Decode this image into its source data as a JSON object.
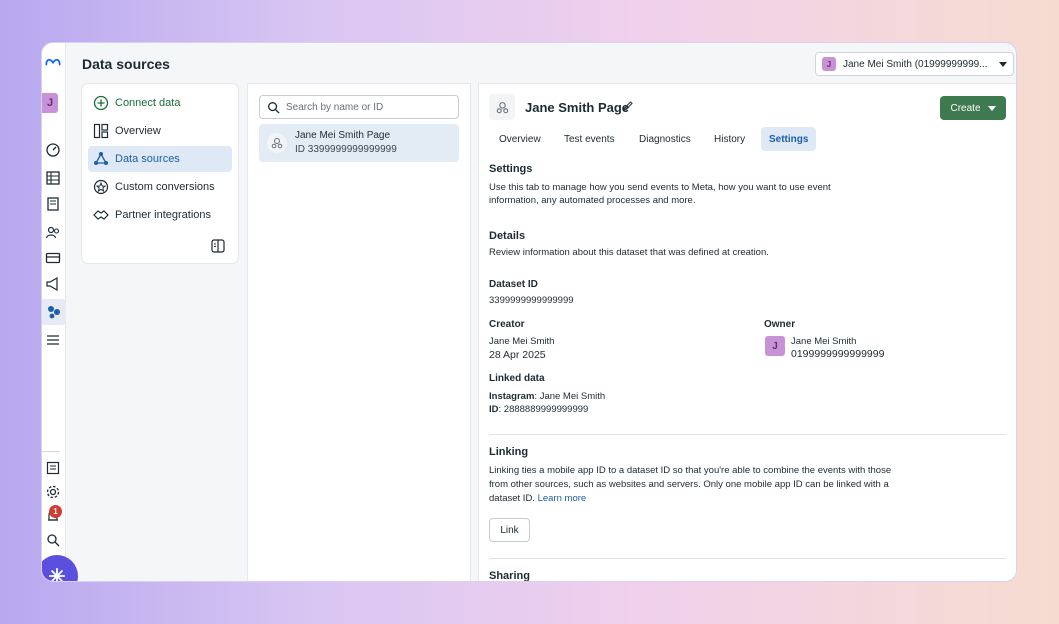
{
  "header": {
    "title": "Data sources",
    "account_name": "Jane Mei Smith (01999999999...",
    "account_initial": "J"
  },
  "rail": {
    "avatar_initial": "J",
    "notification_count": "1"
  },
  "nav": {
    "items": [
      {
        "label": "Connect data",
        "icon": "plus-circle-icon"
      },
      {
        "label": "Overview",
        "icon": "layout-icon"
      },
      {
        "label": "Data sources",
        "icon": "network-icon"
      },
      {
        "label": "Custom conversions",
        "icon": "star-circle-icon"
      },
      {
        "label": "Partner integrations",
        "icon": "handshake-icon"
      }
    ]
  },
  "list": {
    "search_placeholder": "Search by name or ID",
    "items": [
      {
        "name": "Jane Mei Smith Page",
        "id": "ID 3399999999999999"
      }
    ]
  },
  "detail": {
    "title": "Jane Smith Page",
    "create_label": "Create",
    "tabs": [
      "Overview",
      "Test events",
      "Diagnostics",
      "History",
      "Settings"
    ],
    "active_tab": "Settings",
    "settings_heading": "Settings",
    "settings_desc_1": "Use this tab to manage how you send events to Meta, how you want to use event",
    "settings_desc_2": "information, any automated processes and more.",
    "details_heading": "Details",
    "details_desc": "Review information about this dataset that was defined at creation.",
    "dataset_id_label": "Dataset ID",
    "dataset_id": "3399999999999999",
    "creator_label": "Creator",
    "creator_name": "Jane Mei Smith",
    "creator_date": "28 Apr 2025",
    "owner_label": "Owner",
    "owner_initial": "J",
    "owner_name": "Jane Mei Smith",
    "owner_id": "0199999999999999",
    "linked_label": "Linked data",
    "linked_platform": "Instagram",
    "linked_name": "Jane Mei Smith",
    "linked_id_label": "ID",
    "linked_id": "2888889999999999",
    "linking_heading": "Linking",
    "linking_desc_1": "Linking ties a mobile app ID to a dataset ID so that you're able to combine the events with those",
    "linking_desc_2": "from other sources, such as websites and servers. Only one mobile app ID can be linked with a",
    "linking_desc_3": "dataset ID.",
    "learn_more": "Learn more",
    "link_button": "Link",
    "sharing_heading": "Sharing"
  },
  "colors": {
    "accent_blue": "#1c5fa8",
    "create_green": "#3d7a4f",
    "active_bg": "#dfe9f5",
    "avatar_purple": "#c792d6"
  }
}
